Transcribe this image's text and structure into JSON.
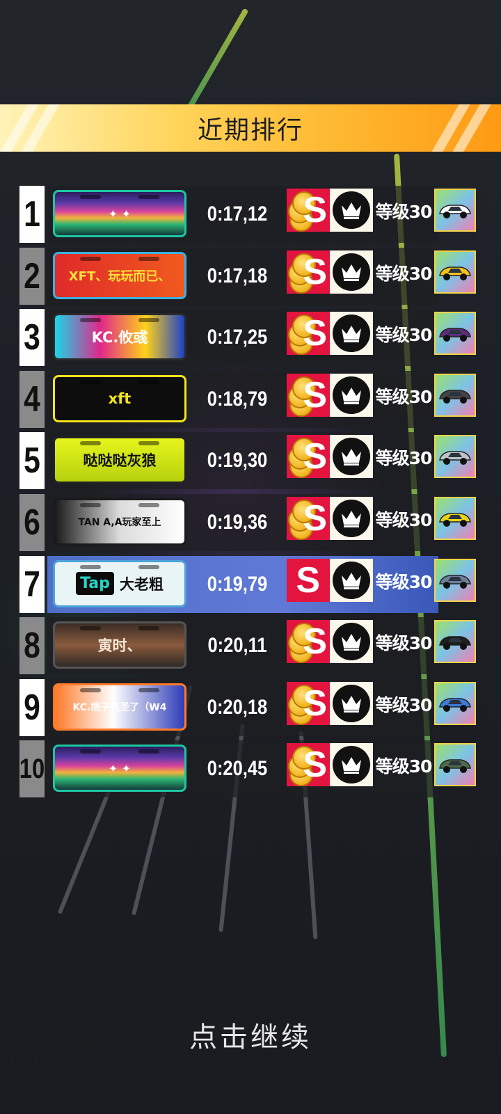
{
  "title": "近期排行",
  "level_label": "等级30",
  "continue_label": "点击继续",
  "rows": [
    {
      "rank": "1",
      "time": "0:17,12",
      "plate_text": "",
      "plate_style": "aurora",
      "car_color": "#ffffff",
      "has_coins": true,
      "highlight": false
    },
    {
      "rank": "2",
      "time": "0:17,18",
      "plate_text": "XFT、玩玩而已、",
      "plate_style": "red",
      "car_color": "#f3c21b",
      "has_coins": true,
      "highlight": false
    },
    {
      "rank": "3",
      "time": "0:17,25",
      "plate_text": "KC.攸彧",
      "plate_style": "graffiti",
      "car_color": "#5b2d7a",
      "has_coins": true,
      "highlight": false
    },
    {
      "rank": "4",
      "time": "0:18,79",
      "plate_text": "xft",
      "plate_style": "black-yellow",
      "car_color": "#444444",
      "has_coins": true,
      "highlight": false
    },
    {
      "rank": "5",
      "time": "0:19,30",
      "plate_text": "哒哒哒灰狼",
      "plate_style": "lime",
      "car_color": "#bfc3c8",
      "has_coins": true,
      "highlight": false
    },
    {
      "rank": "6",
      "time": "0:19,36",
      "plate_text": "TAN A,A玩家至上",
      "plate_style": "comic",
      "car_color": "#e8d51b",
      "has_coins": true,
      "highlight": false
    },
    {
      "rank": "7",
      "time": "0:19,79",
      "plate_text": "大老粗",
      "plate_style": "tap",
      "plate_brand": "Tap",
      "car_color": "#6c7f9a",
      "has_coins": false,
      "highlight": true
    },
    {
      "rank": "8",
      "time": "0:20,11",
      "plate_text": "寅时、",
      "plate_style": "orange-mech",
      "car_color": "#1d1d1d",
      "has_coins": true,
      "highlight": false
    },
    {
      "rank": "9",
      "time": "0:20,18",
      "plate_text": "KC.痞子气圣了（W4",
      "plate_style": "anime",
      "car_color": "#3b7bd9",
      "has_coins": true,
      "highlight": false
    },
    {
      "rank": "10",
      "time": "0:20,45",
      "plate_text": "",
      "plate_style": "aurora",
      "car_color": "#4c6b4a",
      "has_coins": true,
      "highlight": false
    }
  ]
}
